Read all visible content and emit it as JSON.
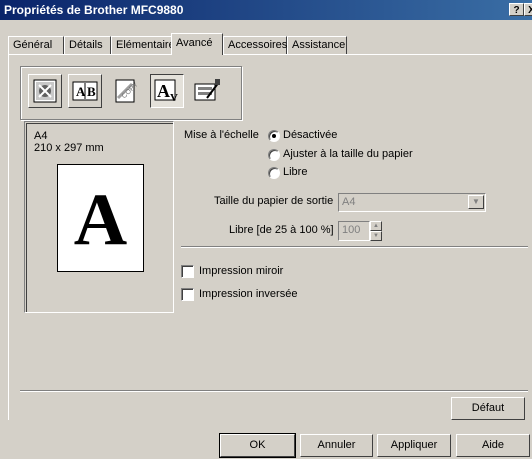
{
  "window": {
    "title": "Propriétés de Brother MFC9880",
    "help_btn": "?",
    "close_btn": "X"
  },
  "tabs": [
    "Général",
    "Détails",
    "Elémentaire",
    "Avancé",
    "Accessoires",
    "Assistance"
  ],
  "active_tab": "Avancé",
  "toolbar_icons": [
    "watermark-icon",
    "ab-duplex-icon",
    "copy-icon",
    "scaling-a-icon",
    "settings-icon"
  ],
  "preview": {
    "paper": "A4",
    "dimensions": "210 x 297 mm",
    "letter": "A"
  },
  "scaling": {
    "label": "Mise à l'échelle",
    "options": [
      "Désactivée",
      "Ajuster à la taille du papier",
      "Libre"
    ],
    "selected": "Désactivée"
  },
  "output_paper": {
    "label": "Taille du papier de sortie",
    "value": "A4"
  },
  "free": {
    "label": "Libre [de 25 à 100 %]",
    "value": "100"
  },
  "checks": {
    "mirror": "Impression miroir",
    "reverse": "Impression inversée"
  },
  "buttons": {
    "default": "Défaut",
    "ok": "OK",
    "cancel": "Annuler",
    "apply": "Appliquer",
    "help": "Aide"
  }
}
